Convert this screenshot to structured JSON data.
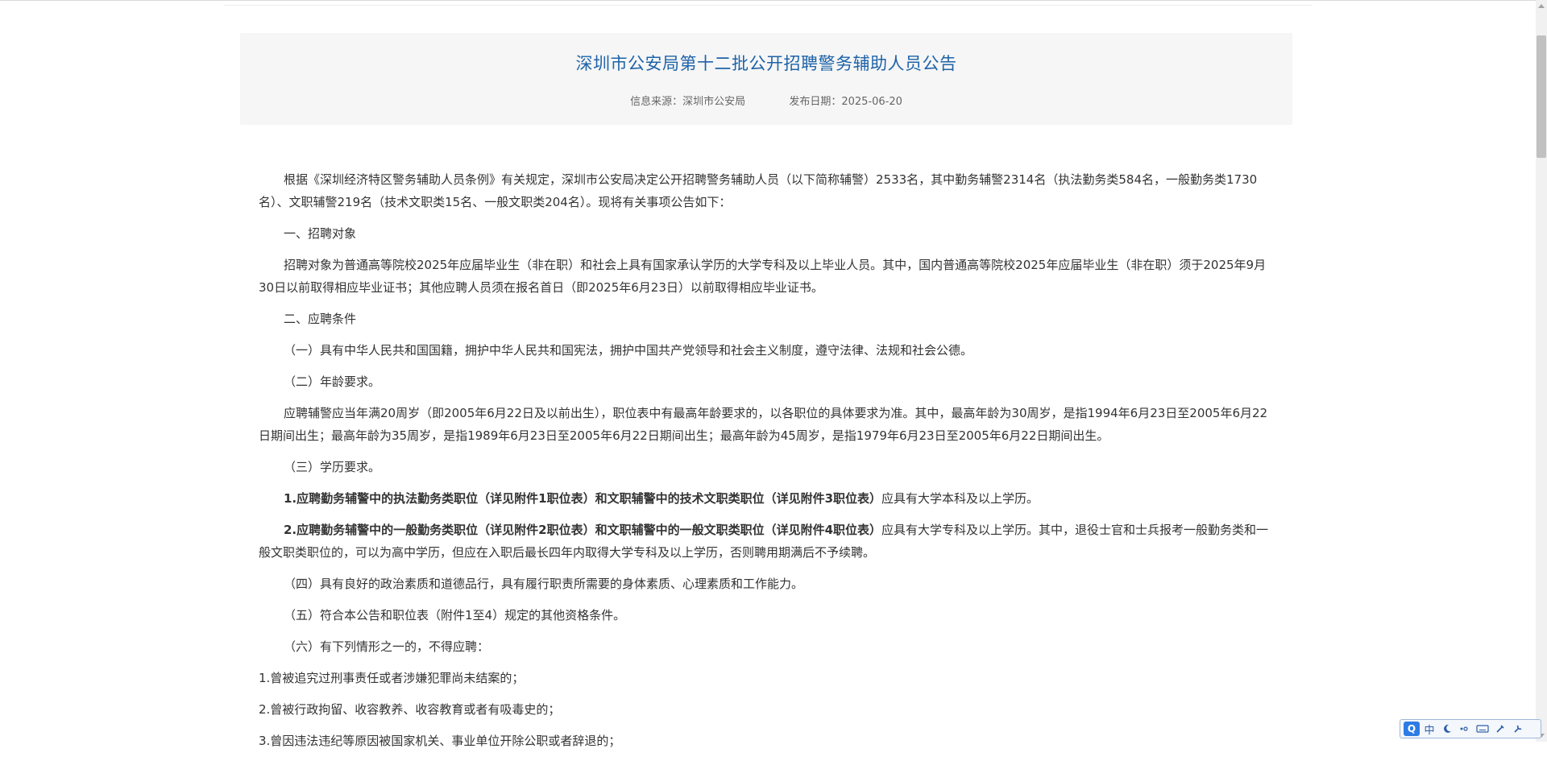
{
  "article": {
    "title": "深圳市公安局第十二批公开招聘警务辅助人员公告",
    "source": "信息来源：深圳市公安局",
    "date": "发布日期：2025-06-20"
  },
  "body": {
    "p1": "根据《深圳经济特区警务辅助人员条例》有关规定，深圳市公安局决定公开招聘警务辅助人员（以下简称辅警）2533名，其中勤务辅警2314名（执法勤务类584名，一般勤务类1730名）、文职辅警219名（技术文职类15名、一般文职类204名）。现将有关事项公告如下：",
    "h1": "一、招聘对象",
    "p2": "招聘对象为普通高等院校2025年应届毕业生（非在职）和社会上具有国家承认学历的大学专科及以上毕业人员。其中，国内普通高等院校2025年应届毕业生（非在职）须于2025年9月30日以前取得相应毕业证书；其他应聘人员须在报名首日（即2025年6月23日）以前取得相应毕业证书。",
    "h2": "二、应聘条件",
    "c1": "（一）具有中华人民共和国国籍，拥护中华人民共和国宪法，拥护中国共产党领导和社会主义制度，遵守法律、法规和社会公德。",
    "c2": "（二）年龄要求。",
    "c2_detail": "应聘辅警应当年满20周岁（即2005年6月22日及以前出生），职位表中有最高年龄要求的，以各职位的具体要求为准。其中，最高年龄为30周岁，是指1994年6月23日至2005年6月22日期间出生；最高年龄为35周岁，是指1989年6月23日至2005年6月22日期间出生；最高年龄为45周岁，是指1979年6月23日至2005年6月22日期间出生。",
    "c3": "（三）学历要求。",
    "c3_1_bold": "1.应聘勤务辅警中的执法勤务类职位（详见附件1职位表）和文职辅警中的技术文职类职位（详见附件3职位表）",
    "c3_1_rest": "应具有大学本科及以上学历。",
    "c3_2_bold": "2.应聘勤务辅警中的一般勤务类职位（详见附件2职位表）和文职辅警中的一般文职类职位（详见附件4职位表）",
    "c3_2_rest": "应具有大学专科及以上学历。其中，退役士官和士兵报考一般勤务类和一般文职类职位的，可以为高中学历，但应在入职后最长四年内取得大学专科及以上学历，否则聘用期满后不予续聘。",
    "c4": "（四）具有良好的政治素质和道德品行，具有履行职责所需要的身体素质、心理素质和工作能力。",
    "c5": "（五）符合本公告和职位表（附件1至4）规定的其他资格条件。",
    "c6": "（六）有下列情形之一的，不得应聘：",
    "c6_1": "1.曾被追究过刑事责任或者涉嫌犯罪尚未结案的；",
    "c6_2": "2.曾被行政拘留、收容教养、收容教育或者有吸毒史的；",
    "c6_3": "3.曾因违法违纪等原因被国家机关、事业单位开除公职或者辞退的；"
  },
  "ime": {
    "logo": "Q",
    "lang": "中",
    "items": [
      "moon-icon",
      "punct-icon",
      "keyboard-icon",
      "settings-icon",
      "tools-icon"
    ]
  }
}
